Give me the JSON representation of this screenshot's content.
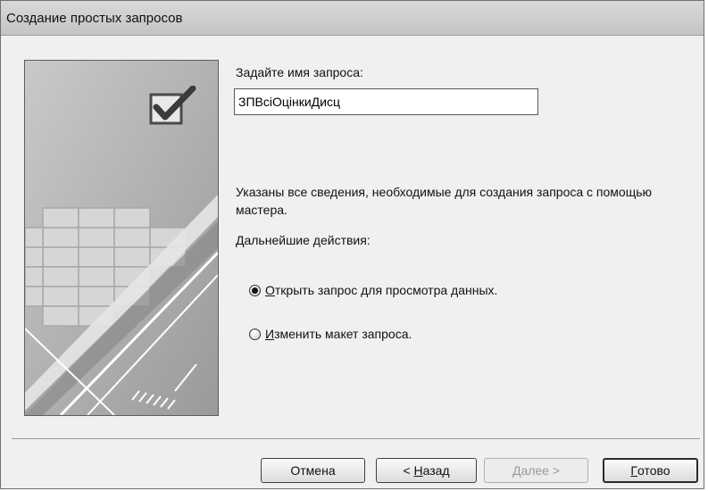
{
  "window": {
    "title": "Создание простых запросов"
  },
  "form": {
    "name_label": "Задайте имя запроса:",
    "name_value": "ЗПВсiОцiнкиДисц",
    "info_text": "Указаны все сведения, необходимые для создания запроса с помощью мастера.",
    "next_actions_label": "Дальнейшие действия:"
  },
  "options": [
    {
      "accel": "О",
      "rest": "ткрыть запрос для просмотра данных.",
      "checked": true
    },
    {
      "accel": "И",
      "rest": "зменить макет запроса.",
      "checked": false
    }
  ],
  "buttons": {
    "cancel": {
      "label": "Отмена"
    },
    "back": {
      "prefix": "< ",
      "accel": "Н",
      "rest": "азад"
    },
    "next": {
      "accel": "Д",
      "rest": "алее >",
      "disabled": true
    },
    "finish": {
      "accel": "Г",
      "rest": "отово"
    }
  },
  "wizard_image": {
    "icon": "checkbox-checked-icon"
  }
}
